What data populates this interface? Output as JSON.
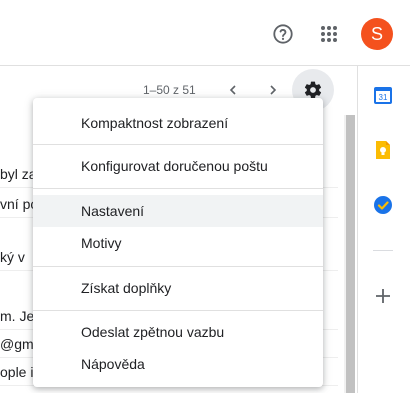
{
  "header": {
    "help_icon": "help-circle-icon",
    "apps_icon": "apps-grid-icon",
    "avatar_letter": "S",
    "avatar_color": "#f4511e"
  },
  "toolbar": {
    "pager_text": "1–50 z 51",
    "prev_icon": "chevron-left-icon",
    "next_icon": "chevron-right-icon",
    "settings_icon": "gear-icon"
  },
  "email_rows": [
    "byl za",
    "vní po",
    "ký v",
    "m. Je",
    "@gma",
    "ople iP"
  ],
  "menu": {
    "items": [
      {
        "label": "Kompaktnost zobrazení"
      },
      {
        "label": "Konfigurovat doručenou poštu"
      },
      {
        "label": "Nastavení"
      },
      {
        "label": "Motivy"
      },
      {
        "label": "Získat doplňky"
      },
      {
        "label": "Odeslat zpětnou vazbu"
      },
      {
        "label": "Nápověda"
      }
    ]
  },
  "side_panel": {
    "calendar_icon": "calendar-icon",
    "calendar_day": "31",
    "keep_icon": "keep-icon",
    "tasks_icon": "tasks-icon",
    "add_icon": "plus-icon",
    "colors": {
      "calendar": "#1a73e8",
      "keep": "#fbbc04",
      "tasks": "#1a73e8"
    }
  }
}
